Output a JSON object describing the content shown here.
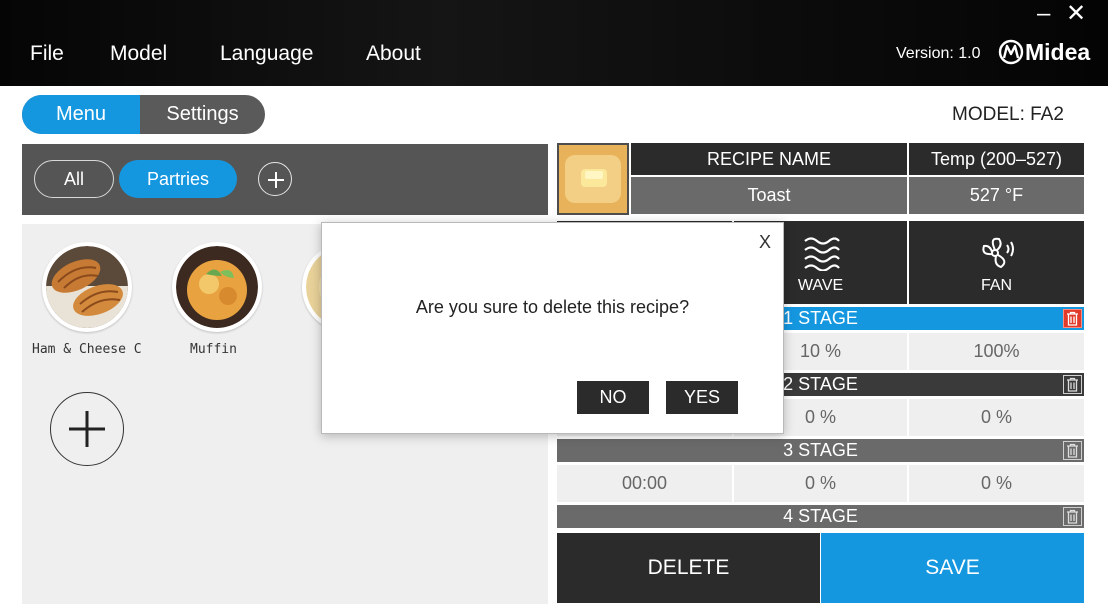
{
  "window": {
    "minimize": "–",
    "close": "✕"
  },
  "menubar": {
    "items": [
      "File",
      "Model",
      "Language",
      "About"
    ]
  },
  "header": {
    "version": "Version: 1.0",
    "brand": "Midea"
  },
  "view_toggle": {
    "menu": "Menu",
    "settings": "Settings"
  },
  "model_label": "MODEL: FA2",
  "categories": {
    "all": "All",
    "partries": "Partries"
  },
  "recipes": [
    {
      "name": "Ham & Cheese C"
    },
    {
      "name": "Muffin"
    }
  ],
  "recipe_header": {
    "name_label": "RECIPE NAME",
    "name_value": "Toast",
    "temp_label": "Temp (200–527)",
    "temp_value": "527 °F"
  },
  "modes": {
    "wave": "WAVE",
    "fan": "FAN"
  },
  "stages": [
    {
      "label": "1 STAGE",
      "time": "",
      "wave": "10 %",
      "fan": "100%"
    },
    {
      "label": "2 STAGE",
      "time": "",
      "wave": "0 %",
      "fan": "0 %"
    },
    {
      "label": "3 STAGE",
      "time": "00:00",
      "wave": "0 %",
      "fan": "0 %"
    },
    {
      "label": "4 STAGE"
    }
  ],
  "actions": {
    "delete": "DELETE",
    "save": "SAVE"
  },
  "dialog": {
    "close": "X",
    "message": "Are you sure to delete  this recipe?",
    "no": "NO",
    "yes": "YES"
  },
  "colors": {
    "accent": "#1597e0",
    "dark": "#2b2b2b",
    "mid": "#6a6a6a",
    "danger": "#e23a2a"
  }
}
